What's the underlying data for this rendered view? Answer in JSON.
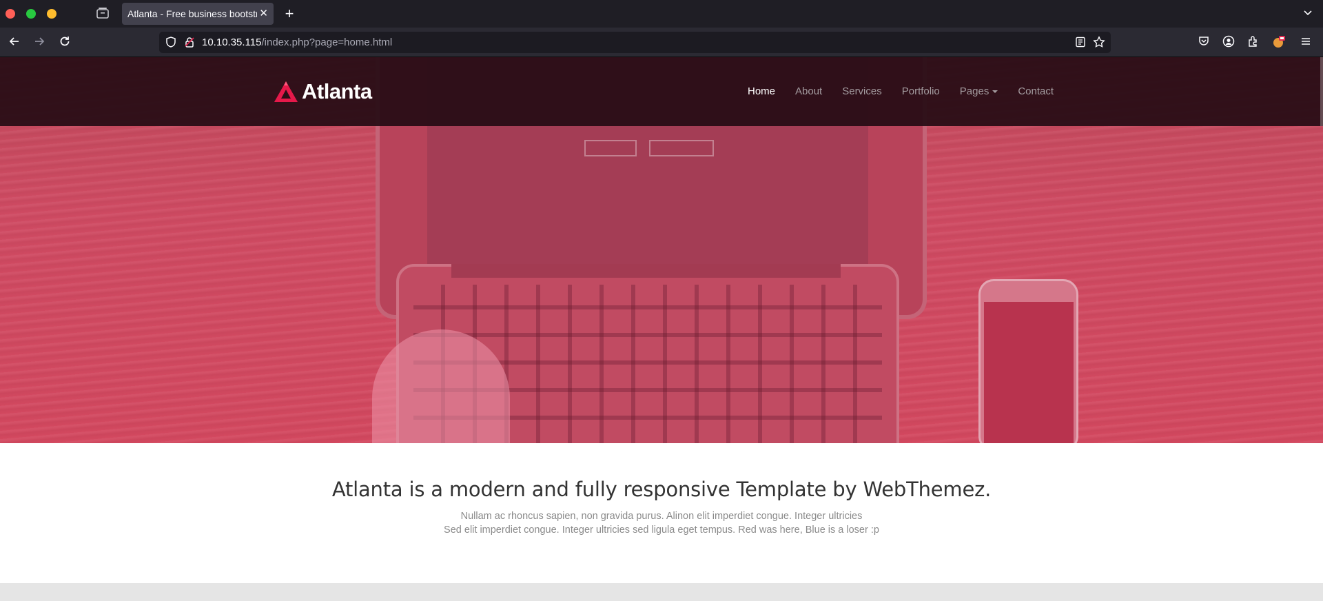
{
  "browser": {
    "tab_title": "Atlanta - Free business bootstrap",
    "url_host": "10.10.35.115",
    "url_path": "/index.php?page=home.html"
  },
  "site": {
    "brand": "Atlanta",
    "accent_color": "#e5194a",
    "nav": [
      {
        "label": "Home",
        "active": true
      },
      {
        "label": "About"
      },
      {
        "label": "Services"
      },
      {
        "label": "Portfolio"
      },
      {
        "label": "Pages"
      },
      {
        "label": "Contact"
      }
    ],
    "hero_overlay_color": "#d3485f"
  },
  "intro": {
    "heading": "Atlanta is a modern and fully responsive Template by WebThemez.",
    "line1": "Nullam ac rhoncus sapien, non gravida purus. Alinon elit imperdiet congue. Integer ultricies",
    "line2": "Sed elit imperdiet congue. Integer ultricies sed ligula eget tempus. Red was here, Blue is a loser :p"
  }
}
